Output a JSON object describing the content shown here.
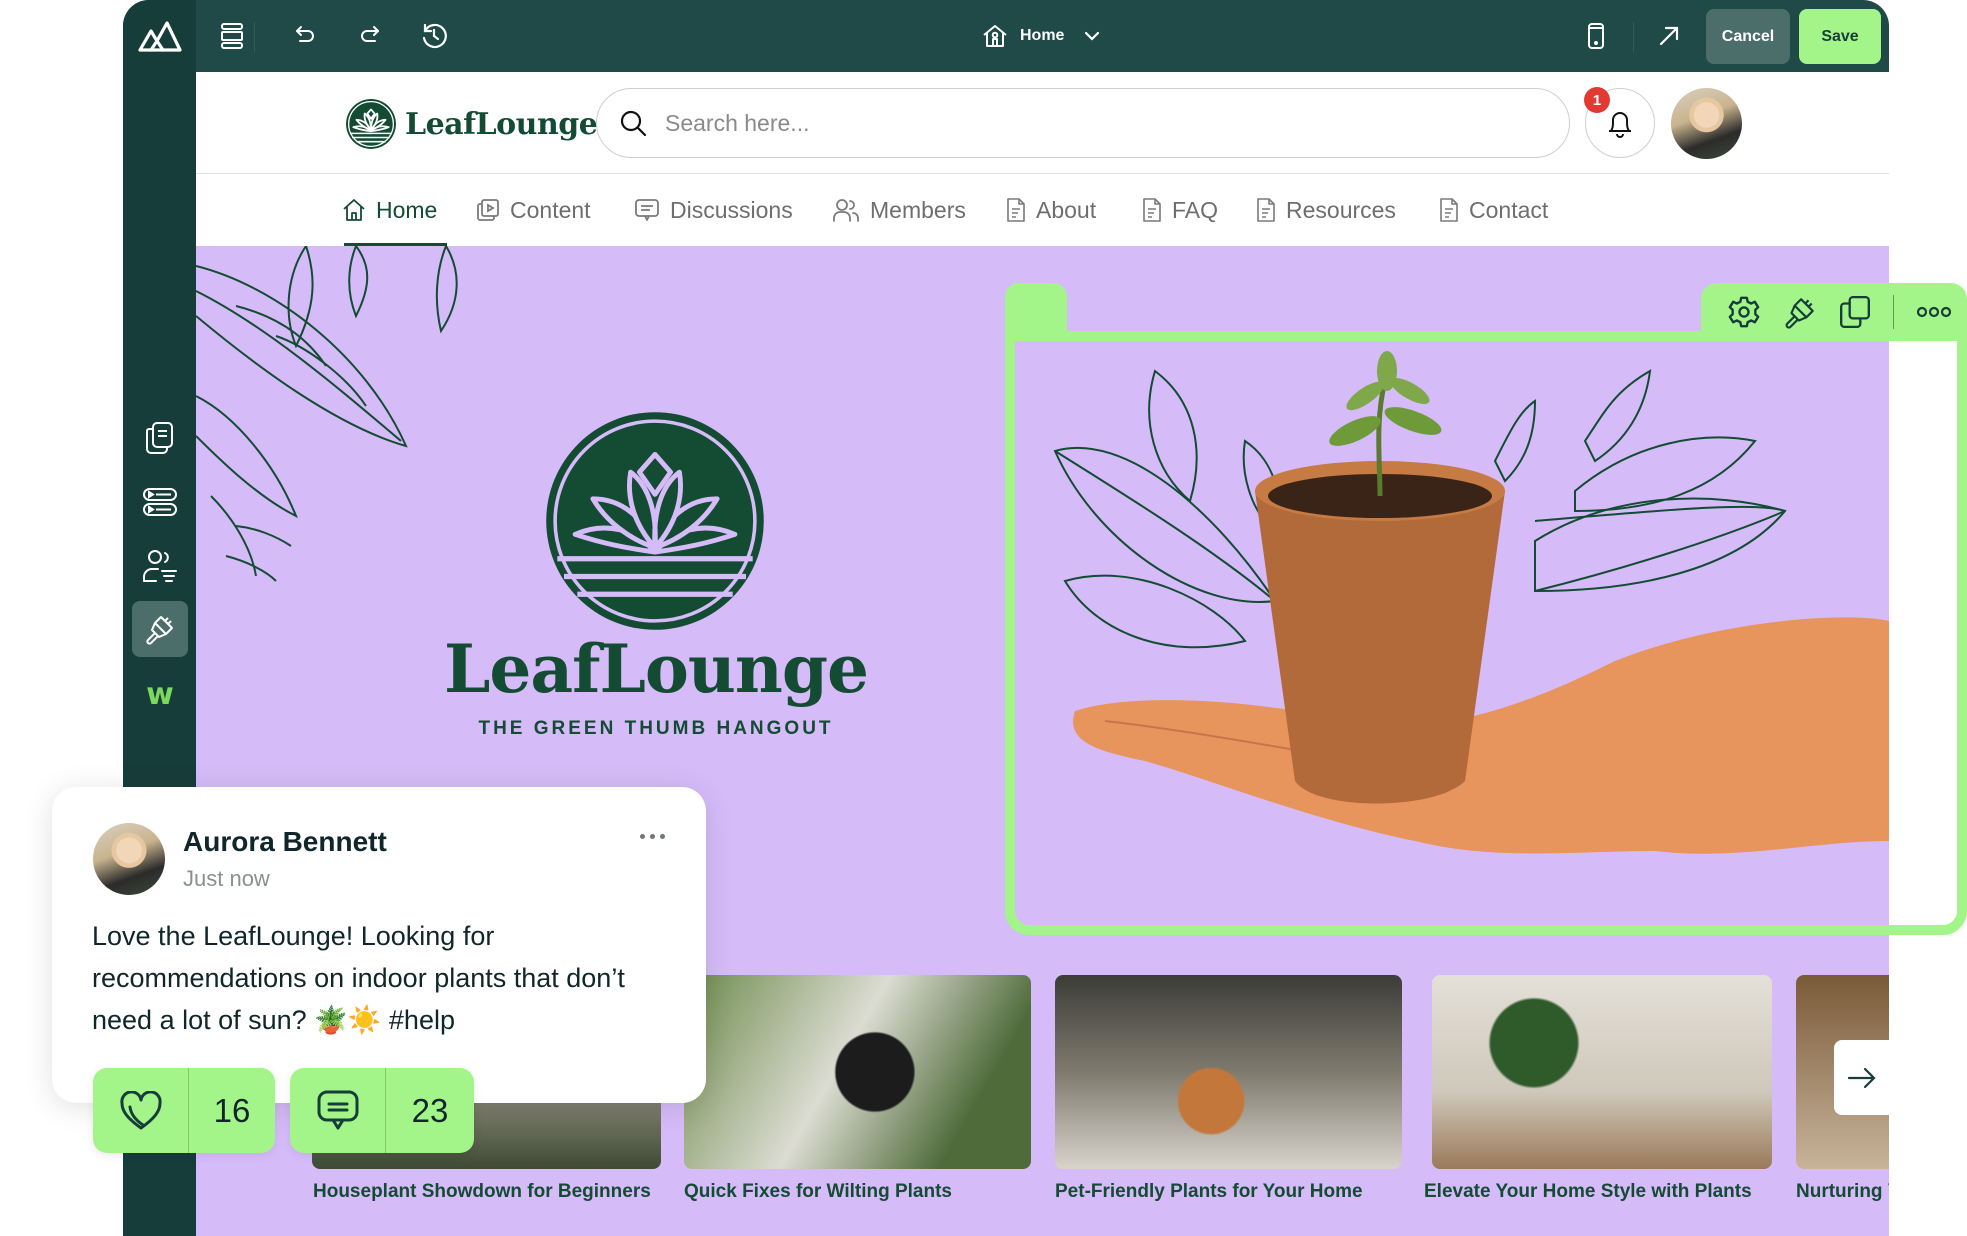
{
  "editor": {
    "toolbar": {
      "page_selector": "Home",
      "cancel_label": "Cancel",
      "save_label": "Save",
      "icons": [
        "app-logo-icon",
        "layout-icon",
        "undo-icon",
        "redo-icon",
        "history-icon",
        "mobile-preview-icon",
        "open-external-icon"
      ]
    },
    "sidebar": {
      "icons": [
        "pages-icon",
        "content-blocks-icon",
        "members-icon",
        "design-brush-icon",
        "brand-w-icon"
      ],
      "active": "design-brush-icon",
      "brand_mark": "w"
    },
    "block_toolbar": {
      "icons": [
        "settings-icon",
        "brush-icon",
        "duplicate-icon",
        "more-icon"
      ]
    }
  },
  "site": {
    "brand_name": "LeafLounge",
    "search": {
      "placeholder": "Search here...",
      "value": ""
    },
    "notifications_count": "1",
    "nav": [
      {
        "label": "Home",
        "icon": "home-icon",
        "active": true
      },
      {
        "label": "Content",
        "icon": "content-icon",
        "active": false
      },
      {
        "label": "Discussions",
        "icon": "discussions-icon",
        "active": false
      },
      {
        "label": "Members",
        "icon": "members-icon",
        "active": false
      },
      {
        "label": "About",
        "icon": "page-icon",
        "active": false
      },
      {
        "label": "FAQ",
        "icon": "page-icon",
        "active": false
      },
      {
        "label": "Resources",
        "icon": "page-icon",
        "active": false
      },
      {
        "label": "Contact",
        "icon": "page-icon",
        "active": false
      }
    ],
    "hero": {
      "title": "LeafLounge",
      "tagline": "THE GREEN THUMB HANGOUT",
      "background": "#d5bcf9"
    },
    "cards": [
      {
        "title": "Houseplant Showdown for Beginners"
      },
      {
        "title": "Quick Fixes for Wilting Plants"
      },
      {
        "title": "Pet-Friendly Plants for Your Home"
      },
      {
        "title": "Elevate Your Home Style with Plants"
      },
      {
        "title": "Nurturing Y"
      }
    ]
  },
  "post": {
    "author": "Aurora Bennett",
    "time": "Just now",
    "body": "Love the LeafLounge! Looking for recommendations on indoor plants that don’t need a lot of sun? 🪴☀️ #help",
    "likes": "16",
    "comments": "23"
  },
  "colors": {
    "editor_dark": "#1f4a48",
    "sidebar_dark": "#163d3a",
    "accent_green": "#a3f58a",
    "brand_green": "#134b33",
    "hero_lavender": "#d5bcf9",
    "badge_red": "#e23a33"
  }
}
